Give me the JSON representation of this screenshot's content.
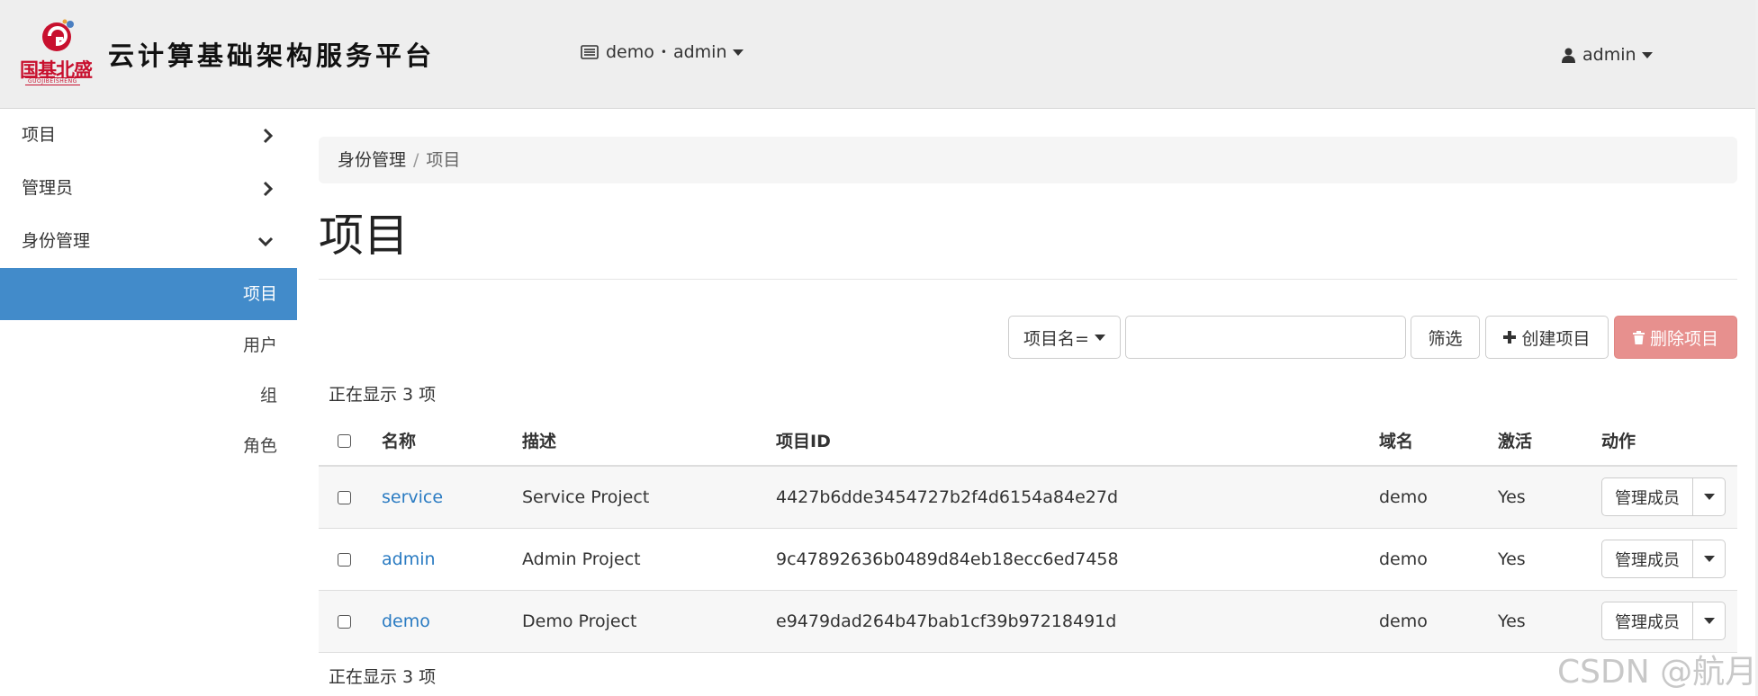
{
  "brand": {
    "logo_text": "国基北盛",
    "logo_sub": "GUOJIBEISHENG",
    "title": "云计算基础架构服务平台"
  },
  "context": {
    "project": "demo",
    "separator": "•",
    "user": "admin"
  },
  "user_menu": {
    "label": "admin"
  },
  "sidebar": {
    "items": [
      {
        "label": "项目",
        "state": "collapsed"
      },
      {
        "label": "管理员",
        "state": "collapsed"
      },
      {
        "label": "身份管理",
        "state": "expanded"
      }
    ],
    "sub_items": [
      {
        "label": "项目",
        "active": true
      },
      {
        "label": "用户",
        "active": false
      },
      {
        "label": "组",
        "active": false
      },
      {
        "label": "角色",
        "active": false
      }
    ]
  },
  "breadcrumb": {
    "parent": "身份管理",
    "separator": "/",
    "current": "项目"
  },
  "page_title": "项目",
  "toolbar": {
    "filter_select": "项目名=",
    "filter_input_value": "",
    "filter_button": "筛选",
    "create_button": "创建项目",
    "delete_button": "删除项目"
  },
  "count_text": "正在显示 3 项",
  "table": {
    "headers": [
      "名称",
      "描述",
      "项目ID",
      "域名",
      "激活",
      "动作"
    ],
    "rows": [
      {
        "name": "service",
        "description": "Service Project",
        "id": "4427b6dde3454727b2f4d6154a84e27d",
        "domain": "demo",
        "enabled": "Yes",
        "action": "管理成员"
      },
      {
        "name": "admin",
        "description": "Admin Project",
        "id": "9c47892636b0489d84eb18ecc6ed7458",
        "domain": "demo",
        "enabled": "Yes",
        "action": "管理成员"
      },
      {
        "name": "demo",
        "description": "Demo Project",
        "id": "e9479dad264b47bab1cf39b97218491d",
        "domain": "demo",
        "enabled": "Yes",
        "action": "管理成员"
      }
    ]
  },
  "watermark": "CSDN @航月",
  "colors": {
    "navbar_bg": "#eeeeee",
    "active_nav": "#428bca",
    "link": "#2a7bc2",
    "danger_btn": "#e7908e",
    "brand_red": "#c8102e"
  },
  "icons": {
    "context": "server-list-icon",
    "user": "user-icon",
    "collapsed": "chevron-right-icon",
    "expanded": "chevron-down-icon",
    "create": "plus-icon",
    "delete": "trash-icon"
  }
}
